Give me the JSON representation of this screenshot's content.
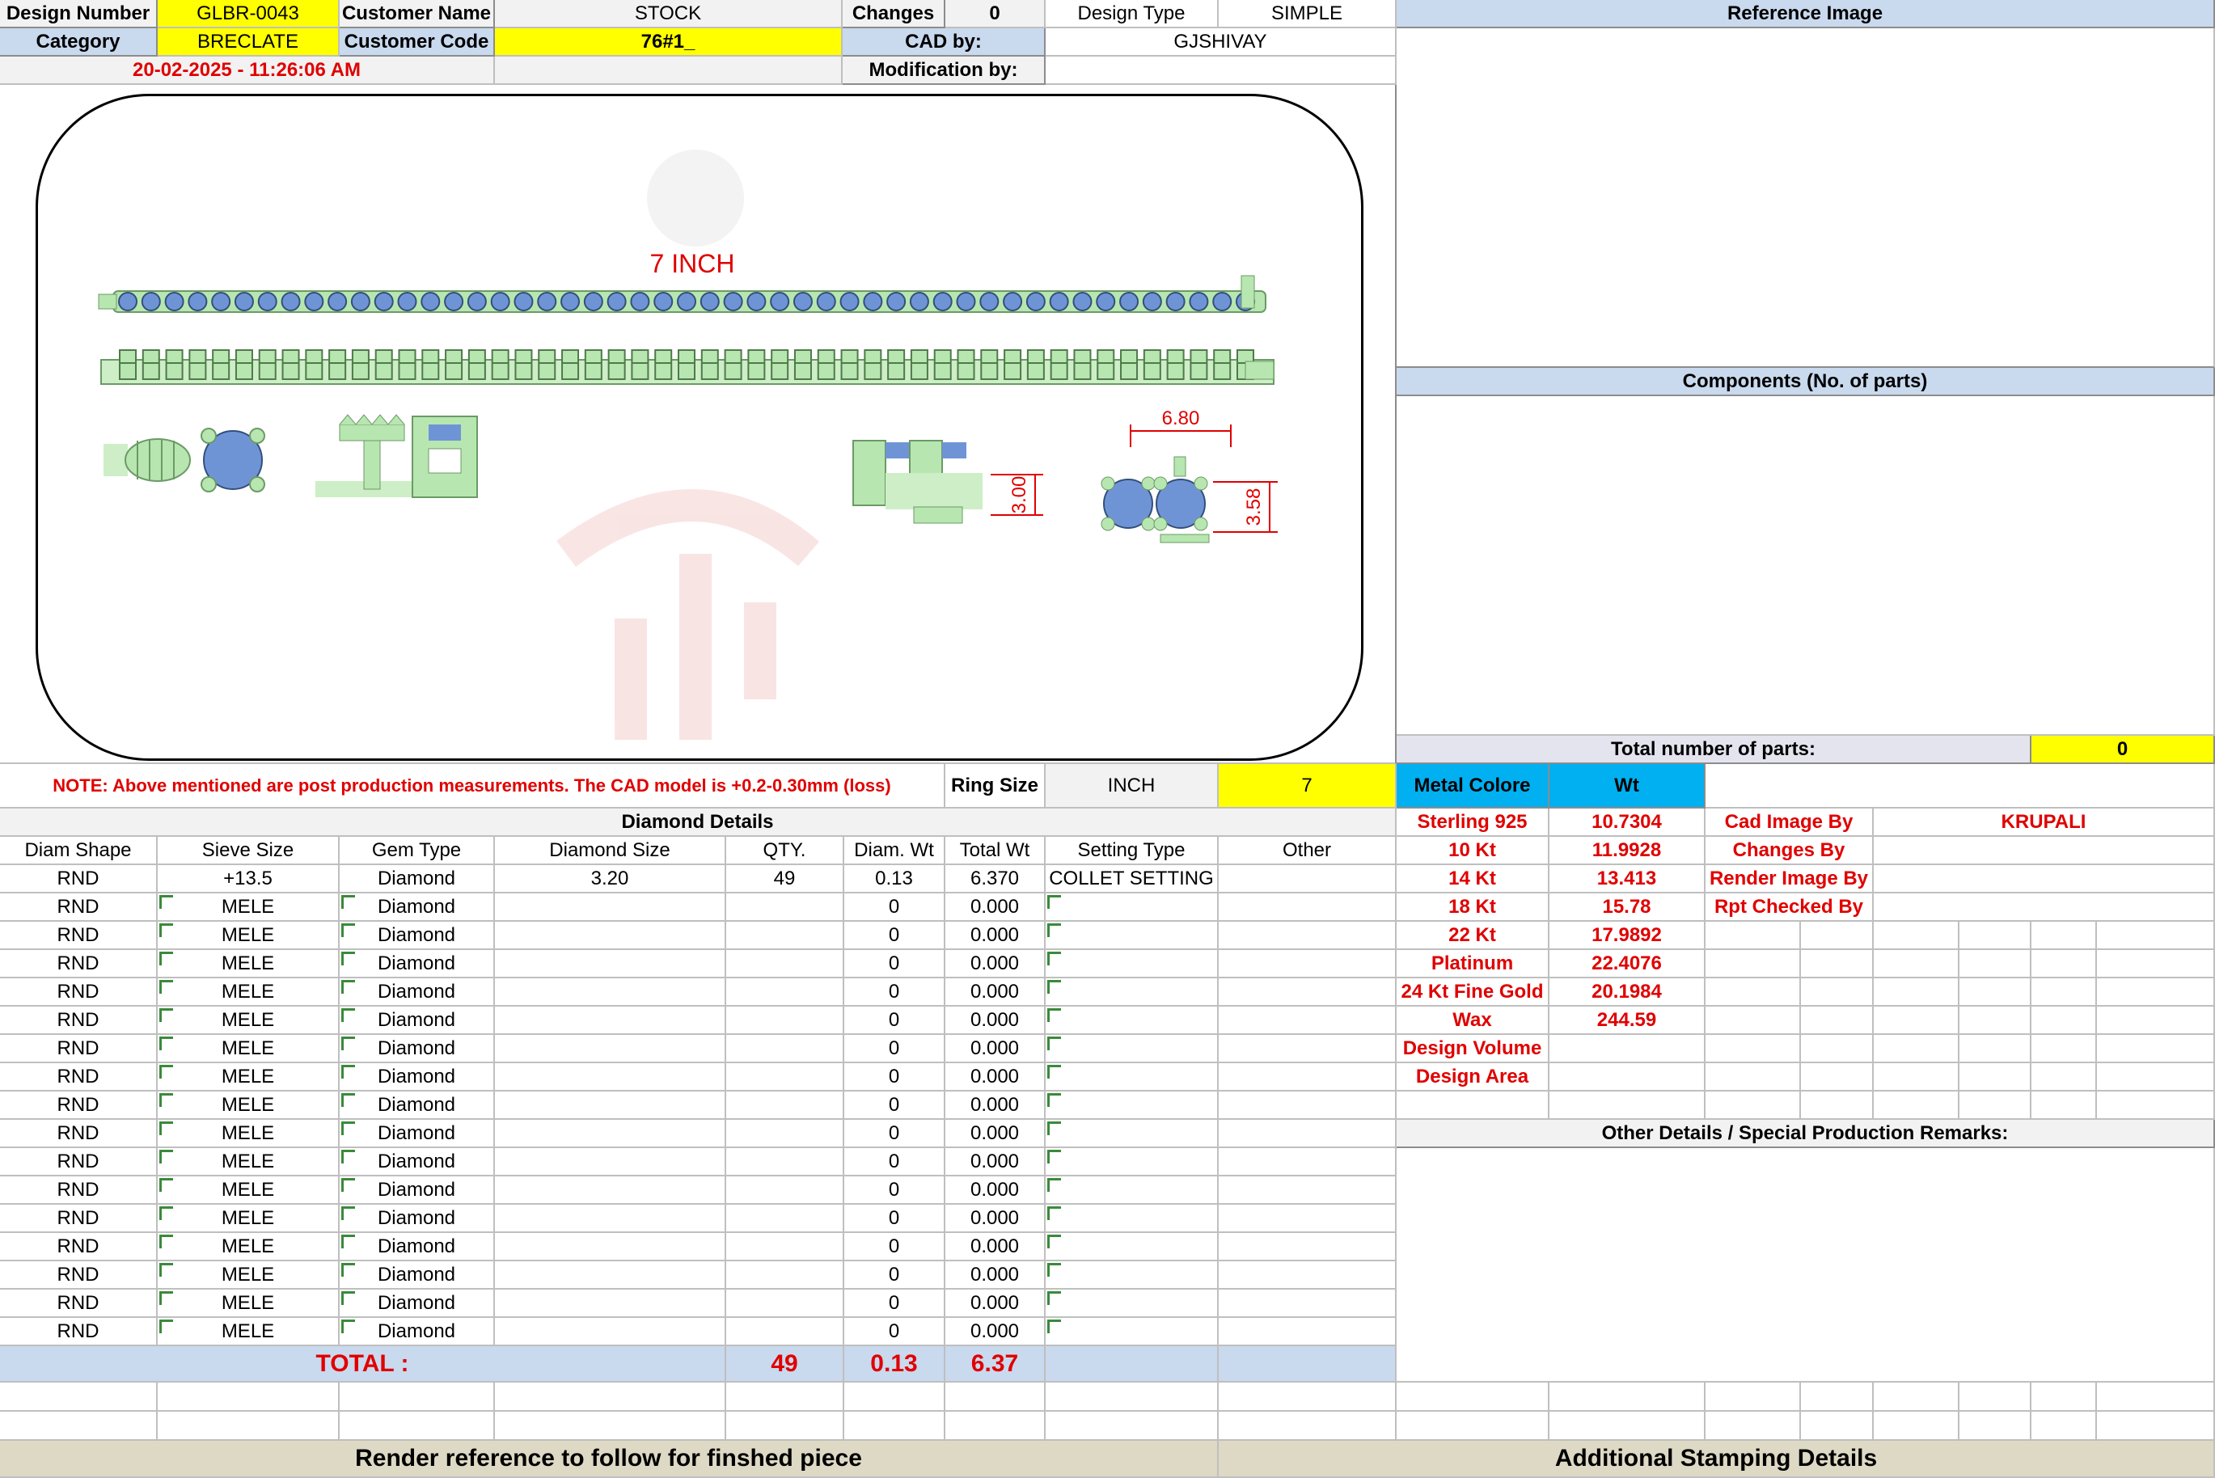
{
  "header": {
    "design_number_label": "Design Number",
    "design_number": "GLBR-0043",
    "customer_name_label": "Customer Name",
    "customer_name": "STOCK",
    "changes_label": "Changes",
    "changes": "0",
    "design_type_label": "Design Type",
    "design_type": "SIMPLE",
    "reference_image_label": "Reference Image",
    "category_label": "Category",
    "category": "BRECLATE",
    "customer_code_label": "Customer Code",
    "customer_code": "76#1_",
    "cad_by_label": "CAD by:",
    "cad_by": "GJSHIVAY",
    "datetime": "20-02-2025 - 11:26:06 AM",
    "modification_by_label": "Modification by:",
    "modification_by": ""
  },
  "drawing": {
    "length_label": "7 INCH",
    "dim_width": "6.80",
    "dim_height_1": "3.00",
    "dim_height_2": "3.58",
    "colors": {
      "metal": "#b8e6b0",
      "stone": "#6f94d6",
      "dimension": "#e00000"
    }
  },
  "components": {
    "title": "Components (No. of parts)",
    "total_parts_label": "Total number of parts:",
    "total_parts": "0"
  },
  "note": "NOTE: Above mentioned are post production measurements. The CAD model is +0.2-0.30mm (loss)",
  "ring_size": {
    "label": "Ring Size",
    "unit": "INCH",
    "value": "7"
  },
  "metal": {
    "header_color": "Metal Colore",
    "header_wt": "Wt",
    "rows": [
      {
        "name": "Sterling 925",
        "wt": "10.7304"
      },
      {
        "name": "10 Kt",
        "wt": "11.9928"
      },
      {
        "name": "14 Kt",
        "wt": "13.413"
      },
      {
        "name": "18 Kt",
        "wt": "15.78"
      },
      {
        "name": "22 Kt",
        "wt": "17.9892"
      },
      {
        "name": "Platinum",
        "wt": "22.4076"
      },
      {
        "name": "24 Kt Fine Gold",
        "wt": "20.1984"
      },
      {
        "name": "Wax",
        "wt": "244.59"
      },
      {
        "name": "Design Volume",
        "wt": ""
      },
      {
        "name": "Design Area",
        "wt": ""
      }
    ]
  },
  "credits": {
    "rows": [
      {
        "label": "Cad Image By",
        "value": "KRUPALI"
      },
      {
        "label": "Changes By",
        "value": ""
      },
      {
        "label": "Render Image By",
        "value": ""
      },
      {
        "label": "Rpt Checked By",
        "value": ""
      }
    ]
  },
  "diamond": {
    "title": "Diamond Details",
    "columns": [
      "Diam Shape",
      "Sieve Size",
      "Gem Type",
      "Diamond Size",
      "QTY.",
      "Diam. Wt",
      "Total Wt",
      "Setting Type",
      "Other"
    ],
    "rows": [
      [
        "RND",
        "+13.5",
        "Diamond",
        "3.20",
        "49",
        "0.13",
        "6.370",
        "COLLET SETTING",
        ""
      ],
      [
        "RND",
        "MELE",
        "Diamond",
        "",
        "",
        "0",
        "0.000",
        "",
        ""
      ],
      [
        "RND",
        "MELE",
        "Diamond",
        "",
        "",
        "0",
        "0.000",
        "",
        ""
      ],
      [
        "RND",
        "MELE",
        "Diamond",
        "",
        "",
        "0",
        "0.000",
        "",
        ""
      ],
      [
        "RND",
        "MELE",
        "Diamond",
        "",
        "",
        "0",
        "0.000",
        "",
        ""
      ],
      [
        "RND",
        "MELE",
        "Diamond",
        "",
        "",
        "0",
        "0.000",
        "",
        ""
      ],
      [
        "RND",
        "MELE",
        "Diamond",
        "",
        "",
        "0",
        "0.000",
        "",
        ""
      ],
      [
        "RND",
        "MELE",
        "Diamond",
        "",
        "",
        "0",
        "0.000",
        "",
        ""
      ],
      [
        "RND",
        "MELE",
        "Diamond",
        "",
        "",
        "0",
        "0.000",
        "",
        ""
      ],
      [
        "RND",
        "MELE",
        "Diamond",
        "",
        "",
        "0",
        "0.000",
        "",
        ""
      ],
      [
        "RND",
        "MELE",
        "Diamond",
        "",
        "",
        "0",
        "0.000",
        "",
        ""
      ],
      [
        "RND",
        "MELE",
        "Diamond",
        "",
        "",
        "0",
        "0.000",
        "",
        ""
      ],
      [
        "RND",
        "MELE",
        "Diamond",
        "",
        "",
        "0",
        "0.000",
        "",
        ""
      ],
      [
        "RND",
        "MELE",
        "Diamond",
        "",
        "",
        "0",
        "0.000",
        "",
        ""
      ],
      [
        "RND",
        "MELE",
        "Diamond",
        "",
        "",
        "0",
        "0.000",
        "",
        ""
      ],
      [
        "RND",
        "MELE",
        "Diamond",
        "",
        "",
        "0",
        "0.000",
        "",
        ""
      ],
      [
        "RND",
        "MELE",
        "Diamond",
        "",
        "",
        "0",
        "0.000",
        "",
        ""
      ]
    ],
    "total_label": "TOTAL :",
    "total_qty": "49",
    "total_diam_wt": "0.13",
    "total_wt": "6.37"
  },
  "other_details_title": "Other Details / Special Production Remarks:",
  "footer": {
    "render_reference": "Render reference to follow for finshed piece",
    "stamping": "Additional Stamping Details"
  }
}
